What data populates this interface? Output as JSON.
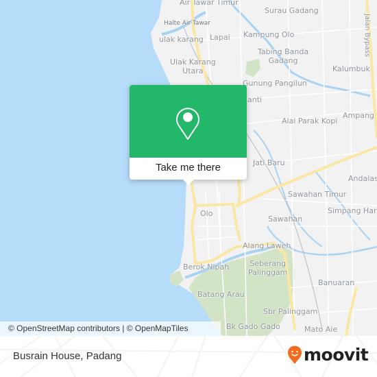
{
  "map": {
    "colors": {
      "water": "#b5dcf8",
      "land": "#f2f2f3",
      "park": "#d3e3c6",
      "major_road": "#fbe7a4",
      "river": "#a9d3f3"
    },
    "places": [
      {
        "name": "Air Tawar Timur"
      },
      {
        "name": "Surau Gadang"
      },
      {
        "name": "Halte Air Tawar"
      },
      {
        "name": "Lapai"
      },
      {
        "name": "Kampung Olo"
      },
      {
        "name": "ulak karang"
      },
      {
        "name": "Tabing Banda\nGadang"
      },
      {
        "name": "Ulak Karang\nUtara"
      },
      {
        "name": "Kalumbuk"
      },
      {
        "name": "Gunung Pangilun"
      },
      {
        "name": "anti"
      },
      {
        "name": "Ampang"
      },
      {
        "name": "Alai Parak Kopi"
      },
      {
        "name": "Jati Baru"
      },
      {
        "name": "Andalas"
      },
      {
        "name": "Sawahan Timur"
      },
      {
        "name": "Simpang Haru"
      },
      {
        "name": "Olo"
      },
      {
        "name": "Sawahan"
      },
      {
        "name": "Alang Laweh"
      },
      {
        "name": "Seberang\nPalinggam"
      },
      {
        "name": "Berok Nipah"
      },
      {
        "name": "Banuaran"
      },
      {
        "name": "Batang Arau"
      },
      {
        "name": "Sbr Palinggam"
      },
      {
        "name": "Bk Gado Gado"
      },
      {
        "name": "Mato Aie"
      },
      {
        "name": "Jalan Bypass"
      }
    ],
    "attribution": "© OpenStreetMap contributors | © OpenMapTiles"
  },
  "popup": {
    "icon": "map-pin-icon",
    "button_label": "Take me there",
    "accent": "#22b769"
  },
  "footer": {
    "location_title": "Busrain House, Padang",
    "brand": "moovit",
    "brand_color": "#f26b21"
  }
}
